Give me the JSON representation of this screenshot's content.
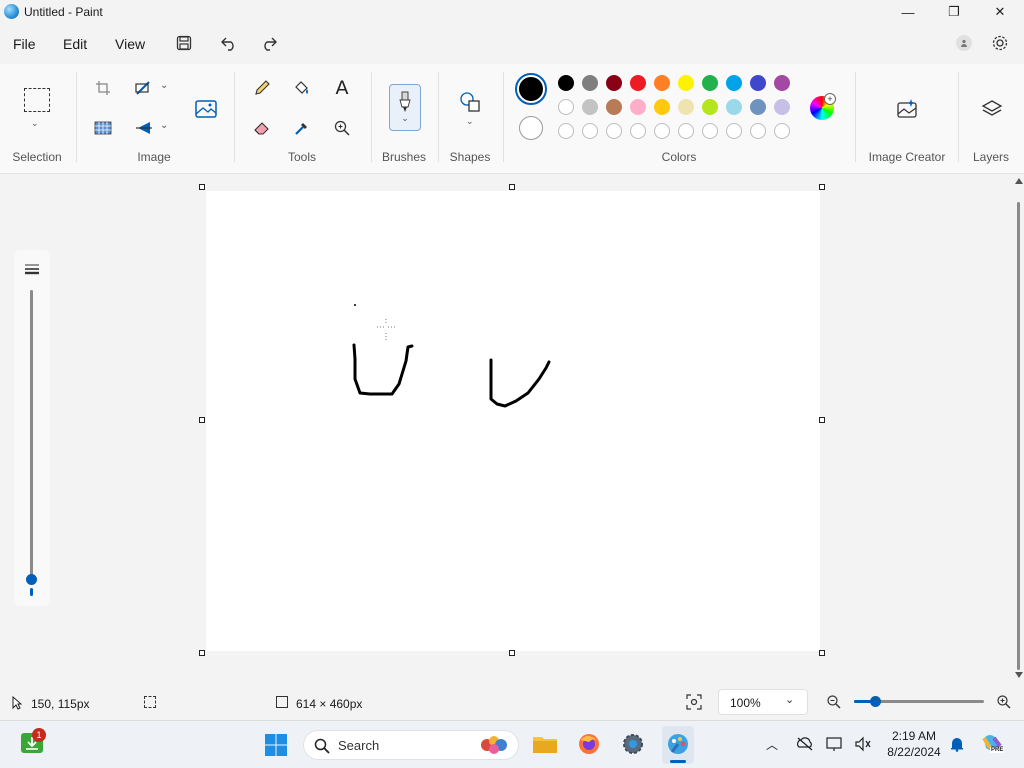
{
  "window": {
    "title": "Untitled - Paint",
    "minimize": "—",
    "maximize": "❐",
    "close": "✕"
  },
  "menu": [
    "File",
    "Edit",
    "View"
  ],
  "ribbon": {
    "groups": {
      "selection": "Selection",
      "image": "Image",
      "tools": "Tools",
      "brushes": "Brushes",
      "shapes": "Shapes",
      "colors": "Colors",
      "image_creator": "Image Creator",
      "layers": "Layers"
    },
    "text_tool_glyph": "A",
    "colors": {
      "primary": "#000000",
      "secondary": "#ffffff",
      "row1": [
        "#000000",
        "#7f7f7f",
        "#880015",
        "#ed1c24",
        "#ff7f27",
        "#fff200",
        "#22b14c",
        "#00a2e8",
        "#3f48cc",
        "#a349a4"
      ],
      "row2": [
        "#ffffff",
        "#c3c3c3",
        "#b97a57",
        "#ffaec9",
        "#ffc90e",
        "#efe4b0",
        "#b5e61d",
        "#99d9ea",
        "#7092be",
        "#c8bfe7"
      ],
      "row3_empty_count": 10
    }
  },
  "accent_color": "#005fb8",
  "status": {
    "cursor_position": "150, 115px",
    "canvas_size": "614 × 460px",
    "zoom": "100%"
  },
  "taskbar": {
    "search_placeholder": "Search",
    "notification_badge": "1",
    "time": "2:19 AM",
    "date": "8/22/2024"
  }
}
